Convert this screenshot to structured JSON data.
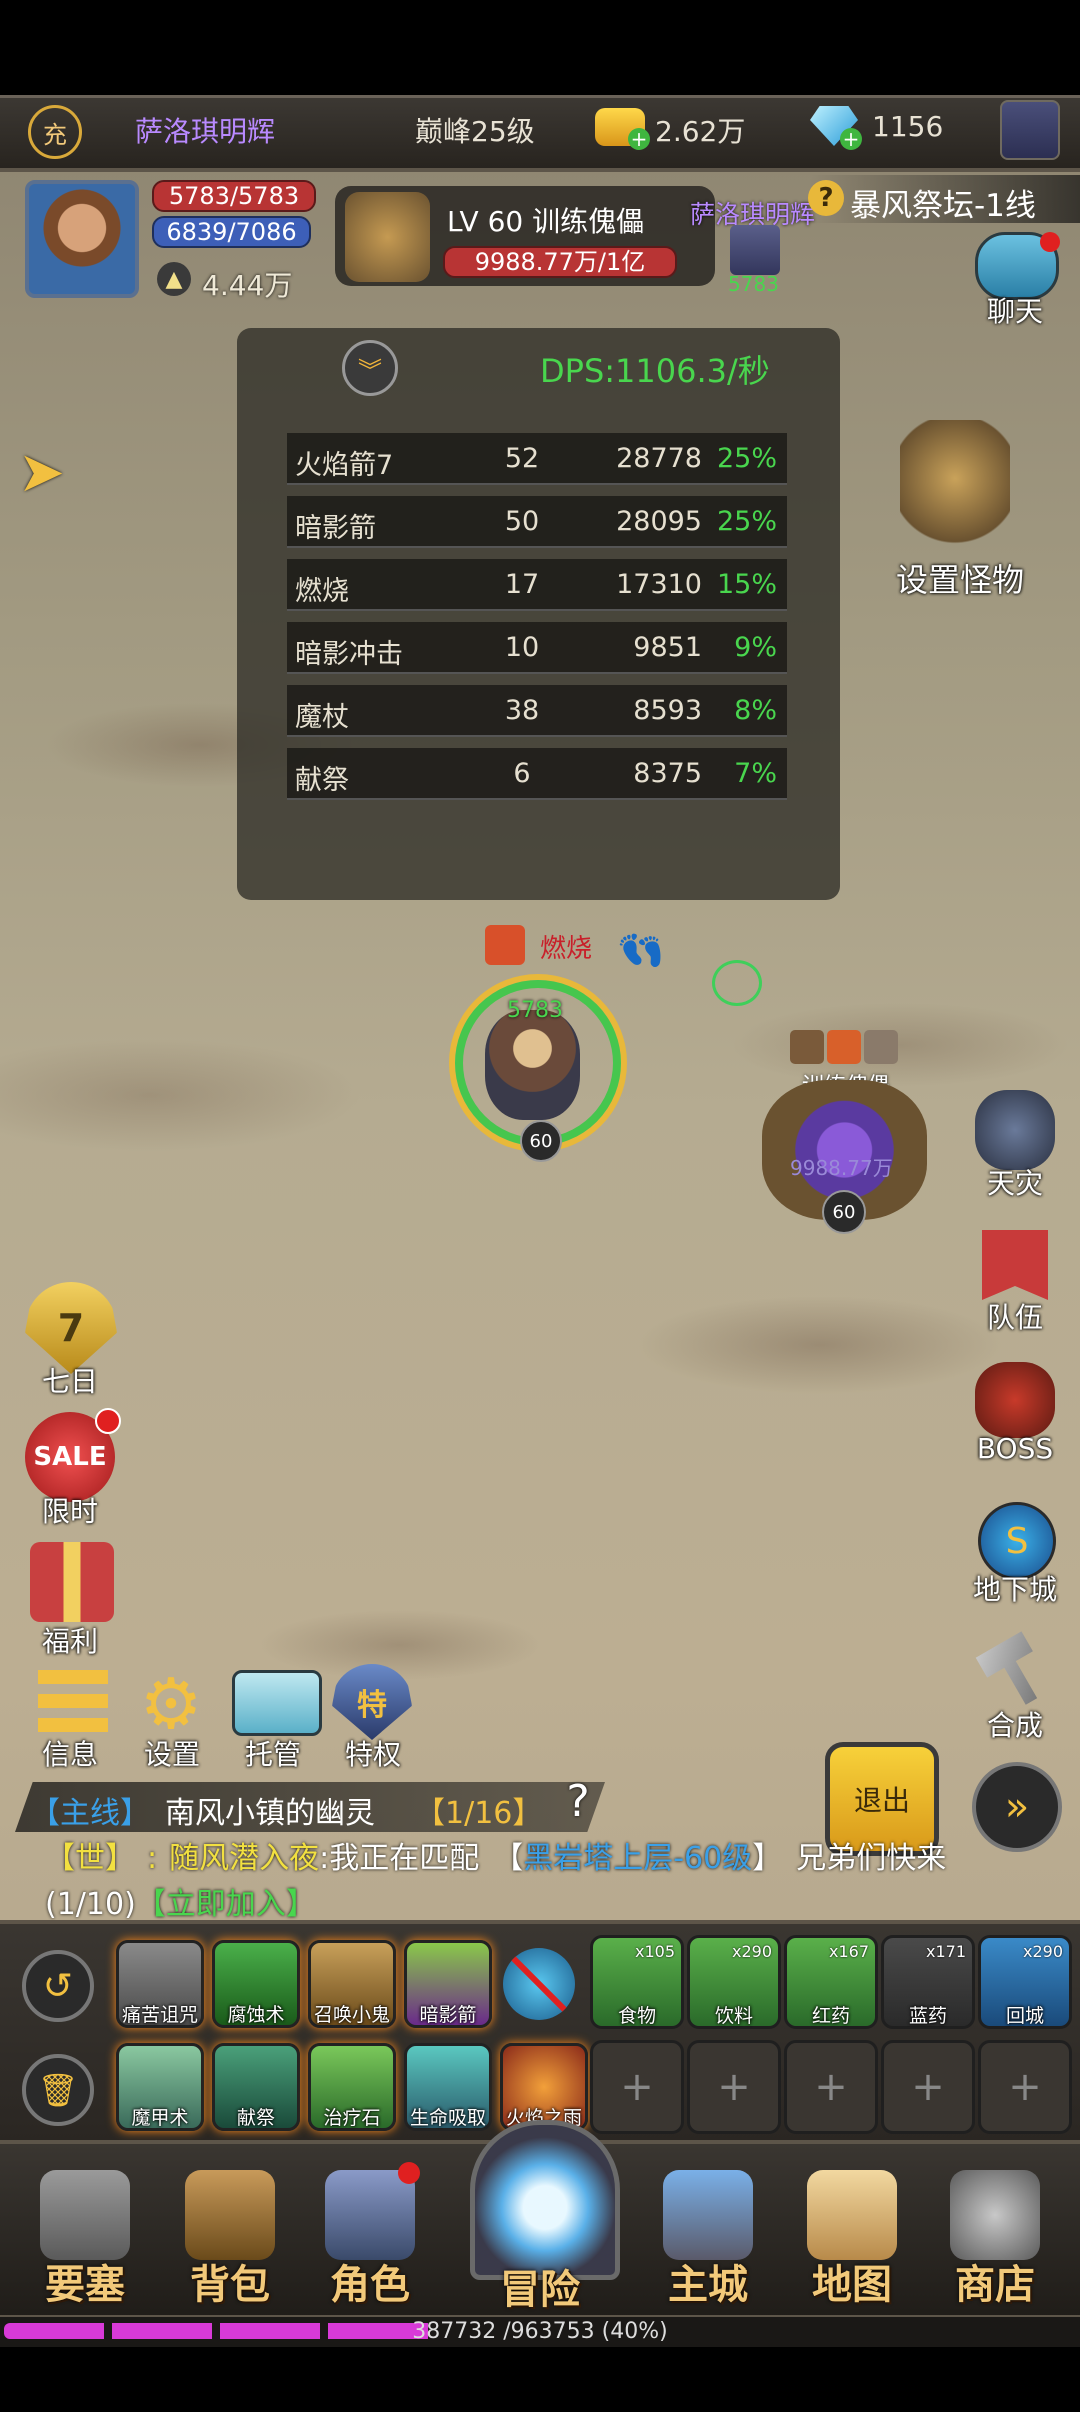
{
  "topbar": {
    "vip_badge": "充",
    "player_name": "萨洛琪明辉",
    "peak_level": "巅峰25级",
    "gold": "2.62万",
    "diamonds": "1156"
  },
  "player": {
    "hp": "5783/5783",
    "mp": "6839/7086",
    "power": "4.44万"
  },
  "target": {
    "title": "LV 60 训练傀儡",
    "hp": "9988.77万/1亿",
    "owner": "萨洛琪明辉",
    "score": "5783"
  },
  "zone": "暴风祭坛-1线",
  "chat_label": "聊天",
  "dps": {
    "title": "DPS:1106.3/秒",
    "rows": [
      {
        "name": "火焰箭7",
        "count": "52",
        "damage": "28778",
        "pct": "25%"
      },
      {
        "name": "暗影箭",
        "count": "50",
        "damage": "28095",
        "pct": "25%"
      },
      {
        "name": "燃烧",
        "count": "17",
        "damage": "17310",
        "pct": "15%"
      },
      {
        "name": "暗影冲击",
        "count": "10",
        "damage": "9851",
        "pct": "9%"
      },
      {
        "name": "魔杖",
        "count": "38",
        "damage": "8593",
        "pct": "8%"
      },
      {
        "name": "献祭",
        "count": "6",
        "damage": "8375",
        "pct": "7%"
      }
    ]
  },
  "set_monster": "设置怪物",
  "battle": {
    "hero_hp": "5783",
    "hero_level": "60",
    "hero_status": "燃烧",
    "monster_name": "训练傀儡",
    "monster_level": "60",
    "monster_hp": "9988.77万"
  },
  "right_menu": [
    "天灾",
    "队伍",
    "BOSS",
    "地下城",
    "合成"
  ],
  "left_menu": {
    "seven_days_num": "7",
    "seven_days": "七日",
    "sale_badge": "SALE",
    "limited": "限时",
    "welfare": "福利"
  },
  "toolbar": [
    "信息",
    "设置",
    "托管",
    "特权"
  ],
  "special_badge": "特",
  "quest": {
    "tag": "【主线】",
    "text": "南风小镇的幽灵",
    "progress": "【1/16】"
  },
  "exit_label": "退出",
  "chat_msg": {
    "channel": "【世】",
    "sep": ":",
    "user": "随风潜入夜",
    "prefix": ":我正在匹配",
    "lb": "【",
    "dungeon": "黑岩塔上层-60级",
    "rb": "】",
    "suffix": "兄弟们快来",
    "count_open": "(",
    "count": "1/10",
    "count_close": ")",
    "join": "【立即加入】"
  },
  "skills_row1": [
    "痛苦诅咒",
    "腐蚀术",
    "召唤小鬼",
    "暗影箭"
  ],
  "items": [
    {
      "name": "食物",
      "count": "x105"
    },
    {
      "name": "饮料",
      "count": "x290"
    },
    {
      "name": "红药",
      "count": "x167"
    },
    {
      "name": "蓝药",
      "count": "x171"
    },
    {
      "name": "回城",
      "count": "x290"
    }
  ],
  "skills_row2": [
    "魔甲术",
    "献祭",
    "治疗石",
    "生命吸取",
    "火焰之雨"
  ],
  "empty_slot": "+",
  "nav": [
    "要塞",
    "背包",
    "角色",
    "冒险",
    "主城",
    "地图",
    "商店"
  ],
  "exp": {
    "text": "387732 /963753 (40%)",
    "fraction": 0.4
  },
  "colors": {
    "gold_text": "#f2c97a",
    "dps_green": "#49d64e",
    "name_purple": "#b98aff",
    "hp_red": "#c83a3a",
    "mp_blue": "#3a63c8"
  }
}
